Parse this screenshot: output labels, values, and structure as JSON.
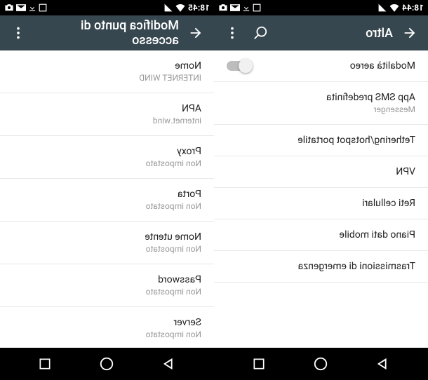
{
  "left": {
    "status": {
      "time": "18:45"
    },
    "header": {
      "title": "Modifica punto di accesso"
    },
    "items": [
      {
        "label": "Nome",
        "value": "INTERNET WIND"
      },
      {
        "label": "APN",
        "value": "internet.wind"
      },
      {
        "label": "Proxy",
        "value": "Non impostato"
      },
      {
        "label": "Porta",
        "value": "Non impostato"
      },
      {
        "label": "Nome utente",
        "value": "Non impostato"
      },
      {
        "label": "Password",
        "value": "Non impostato"
      },
      {
        "label": "Server",
        "value": "Non impostato"
      }
    ]
  },
  "right": {
    "status": {
      "time": "18:44"
    },
    "header": {
      "title": "Altro"
    },
    "items": [
      {
        "label": "Modalità aereo",
        "toggle": true
      },
      {
        "label": "App SMS predefinita",
        "value": "Messenger"
      },
      {
        "label": "Tethering/hotspot portatile"
      },
      {
        "label": "VPN"
      },
      {
        "label": "Reti cellulari"
      },
      {
        "label": "Piano dati mobile"
      },
      {
        "label": "Trasmissioni di emergenza"
      }
    ]
  }
}
